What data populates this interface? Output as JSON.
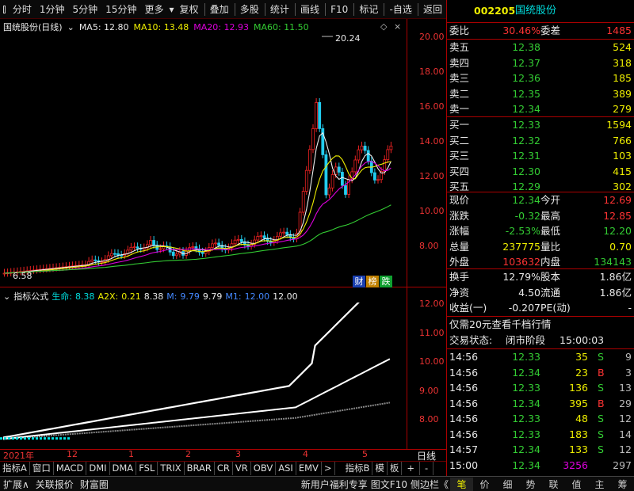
{
  "toolbar": {
    "items": [
      "分时",
      "1分钟",
      "5分钟",
      "15分钟",
      "更多"
    ],
    "right_items": [
      "复权",
      "叠加",
      "多股",
      "统计",
      "画线",
      "F10",
      "标记",
      "-自选",
      "返回"
    ]
  },
  "stock": {
    "code": "002205",
    "name": "国统股份"
  },
  "main_legend": {
    "name": "国统股份(日线)",
    "ma5": "MA5: 12.80",
    "ma10": "MA10: 13.48",
    "ma20": "MA20: 12.93",
    "ma60": "MA60: 11.50"
  },
  "peak_label": "20.24",
  "low_label": "6.58",
  "price_axis": [
    "20.00",
    "18.00",
    "16.00",
    "14.00",
    "12.00",
    "10.00",
    "8.00"
  ],
  "badges": [
    "财",
    "榜",
    "跌"
  ],
  "indicator_legend": {
    "title": "指标公式",
    "life_label": "生命:",
    "life_value": "8.38",
    "a2x_label": "A2X:",
    "a2x_value": "0.21",
    "a2x_val2": "8.38",
    "m_label": "M:",
    "m_value": "9.79",
    "m_val2": "9.79",
    "m1_label": "M1:",
    "m1_value": "12.00",
    "m1_val2": "12.00"
  },
  "ind_axis": [
    "12.00",
    "11.00",
    "10.00",
    "9.00",
    "8.00"
  ],
  "date_axis": [
    "2021年",
    "12",
    "1",
    "2",
    "3",
    "4",
    "5"
  ],
  "date_axis_right": "日线",
  "tabs": [
    "指标A",
    "窗口",
    "MACD",
    "DMI",
    "DMA",
    "FSL",
    "TRIX",
    "BRAR",
    "CR",
    "VR",
    "OBV",
    "ASI",
    "EMV",
    ">",
    "指标B",
    "模",
    "板",
    "+",
    "-"
  ],
  "status": {
    "items": [
      "扩展∧",
      "关联报价",
      "财富圈"
    ],
    "promo": "新用户福利专享",
    "f10": "图文F10",
    "sidebar": "侧边栏《",
    "right_tabs": [
      "笔",
      "价",
      "细",
      "势",
      "联",
      "值",
      "主",
      "筹"
    ]
  },
  "quote": {
    "weibi_label": "委比",
    "weibi": "30.46%",
    "weicha_label": "委差",
    "weicha": "1485",
    "asks": [
      {
        "label": "卖五",
        "price": "12.38",
        "vol": "524"
      },
      {
        "label": "卖四",
        "price": "12.37",
        "vol": "318"
      },
      {
        "label": "卖三",
        "price": "12.36",
        "vol": "185"
      },
      {
        "label": "卖二",
        "price": "12.35",
        "vol": "389"
      },
      {
        "label": "卖一",
        "price": "12.34",
        "vol": "279"
      }
    ],
    "bids": [
      {
        "label": "买一",
        "price": "12.33",
        "vol": "1594"
      },
      {
        "label": "买二",
        "price": "12.32",
        "vol": "766"
      },
      {
        "label": "买三",
        "price": "12.31",
        "vol": "103"
      },
      {
        "label": "买四",
        "price": "12.30",
        "vol": "415"
      },
      {
        "label": "买五",
        "price": "12.29",
        "vol": "302"
      }
    ],
    "stats": [
      {
        "l1": "现价",
        "v1": "12.34",
        "l2": "今开",
        "v2": "12.69"
      },
      {
        "l1": "涨跌",
        "v1": "-0.32",
        "l2": "最高",
        "v2": "12.85"
      },
      {
        "l1": "涨幅",
        "v1": "-2.53%",
        "l2": "最低",
        "v2": "12.20"
      },
      {
        "l1": "总量",
        "v1": "237775",
        "l2": "量比",
        "v2": "0.70"
      },
      {
        "l1": "外盘",
        "v1": "103632",
        "l2": "内盘",
        "v2": "134143"
      }
    ],
    "fund": [
      {
        "l1": "换手",
        "v1": "12.79%",
        "l2": "股本",
        "v2": "1.86亿"
      },
      {
        "l1": "净资",
        "v1": "4.50",
        "l2": "流通",
        "v2": "1.86亿"
      },
      {
        "l1": "收益(一)",
        "v1": "-0.207",
        "l2": "PE(动)",
        "v2": "-"
      }
    ],
    "promo": "仅需20元查看千档行情",
    "trade_state_label": "交易状态:",
    "trade_state": "闭市阶段",
    "trade_time": "15:00:03",
    "ticks": [
      {
        "t": "14:56",
        "p": "12.33",
        "v": "35",
        "d": "S",
        "n": "9"
      },
      {
        "t": "14:56",
        "p": "12.34",
        "v": "23",
        "d": "B",
        "n": "3"
      },
      {
        "t": "14:56",
        "p": "12.33",
        "v": "136",
        "d": "S",
        "n": "13"
      },
      {
        "t": "14:56",
        "p": "12.34",
        "v": "395",
        "d": "B",
        "n": "29"
      },
      {
        "t": "14:56",
        "p": "12.33",
        "v": "48",
        "d": "S",
        "n": "12"
      },
      {
        "t": "14:56",
        "p": "12.33",
        "v": "183",
        "d": "S",
        "n": "14"
      },
      {
        "t": "14:57",
        "p": "12.34",
        "v": "133",
        "d": "S",
        "n": "12"
      },
      {
        "t": "15:00",
        "p": "12.34",
        "v": "3256",
        "d": "",
        "n": "297"
      }
    ]
  }
}
